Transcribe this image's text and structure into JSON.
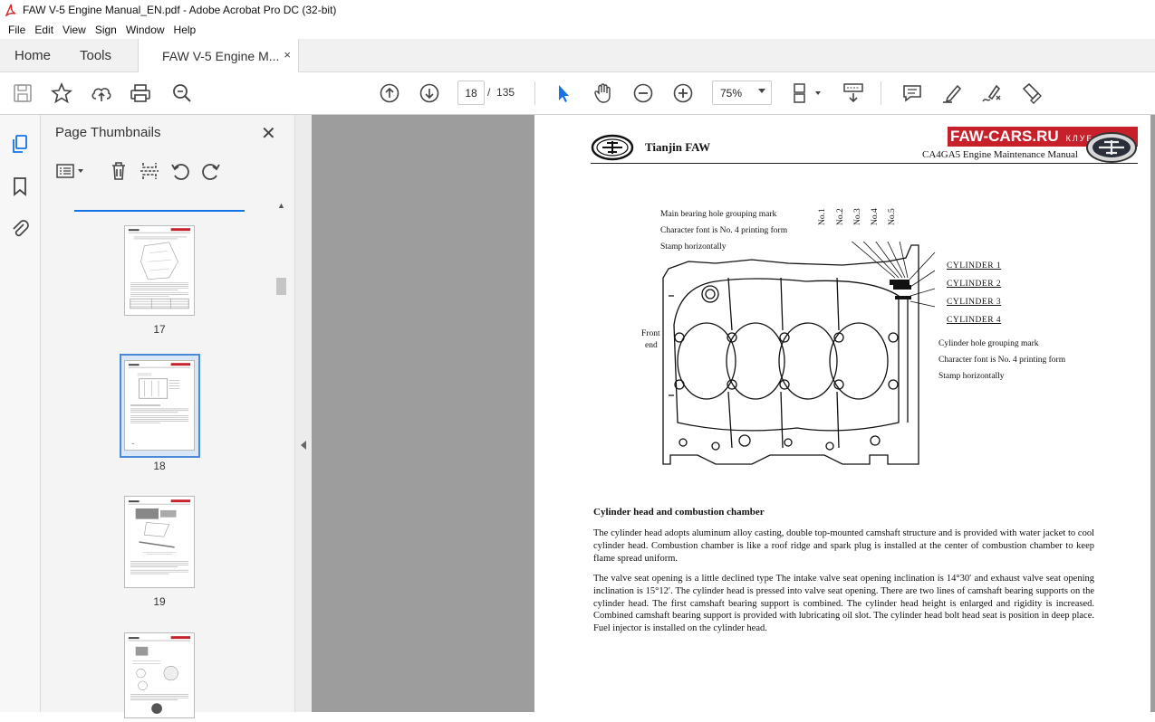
{
  "window": {
    "title": "FAW V-5 Engine Manual_EN.pdf - Adobe Acrobat Pro DC (32-bit)"
  },
  "menu": [
    "File",
    "Edit",
    "View",
    "Sign",
    "Window",
    "Help"
  ],
  "tabs": {
    "home": "Home",
    "tools": "Tools",
    "doc": "FAW V-5 Engine M...",
    "close": "×"
  },
  "toolbar": {
    "page_current": "18",
    "page_sep": "/",
    "page_total": "135",
    "zoom": "75%"
  },
  "panel": {
    "title": "Page Thumbnails",
    "close": "✕"
  },
  "thumbnails": [
    {
      "num": "17",
      "selected": false
    },
    {
      "num": "18",
      "selected": true
    },
    {
      "num": "19",
      "selected": false
    }
  ],
  "document": {
    "header_left": "Tianjin FAW",
    "header_brand": "FAW-CARS.RU",
    "header_brand_sub": "КЛУБ",
    "header_right": "CA4GA5 Engine Maintenance Manual",
    "figure": {
      "label_top_1": "Main bearing hole grouping mark",
      "label_top_2": "Character font is No. 4 printing form",
      "label_top_3": "Stamp horizontally",
      "nos": [
        "No.1",
        "No.2",
        "No.3",
        "No.4",
        "No.5"
      ],
      "cylinders": [
        "CYLINDER 1",
        "CYLINDER 2",
        "CYLINDER 3",
        "CYLINDER 4"
      ],
      "front_1": "Front",
      "front_2": "end",
      "label_right_1": "Cylinder hole grouping mark",
      "label_right_2": "Character font is No. 4 printing form",
      "label_right_3": "Stamp horizontally"
    },
    "section_heading": "Cylinder head and combustion chamber",
    "para1": "The cylinder head adopts aluminum alloy casting, double top-mounted camshaft structure and is provided with water jacket to cool cylinder head. Combustion chamber is like a roof ridge and spark plug is installed at the center of combustion chamber to keep flame spread uniform.",
    "para2": "The valve seat opening is a little declined type The intake valve seat opening inclination is 14°30′ and exhaust valve seat opening inclination is 15°12′.    The cylinder head is pressed into valve seat opening. There are two lines of camshaft bearing supports on the cylinder head.  The first camshaft bearing support is combined.  The cylinder head height is enlarged and rigidity is increased. Combined camshaft bearing support is provided with lubricating oil slot.  The cylinder head bolt head seat is position in deep place. Fuel injector is installed on the cylinder head."
  }
}
